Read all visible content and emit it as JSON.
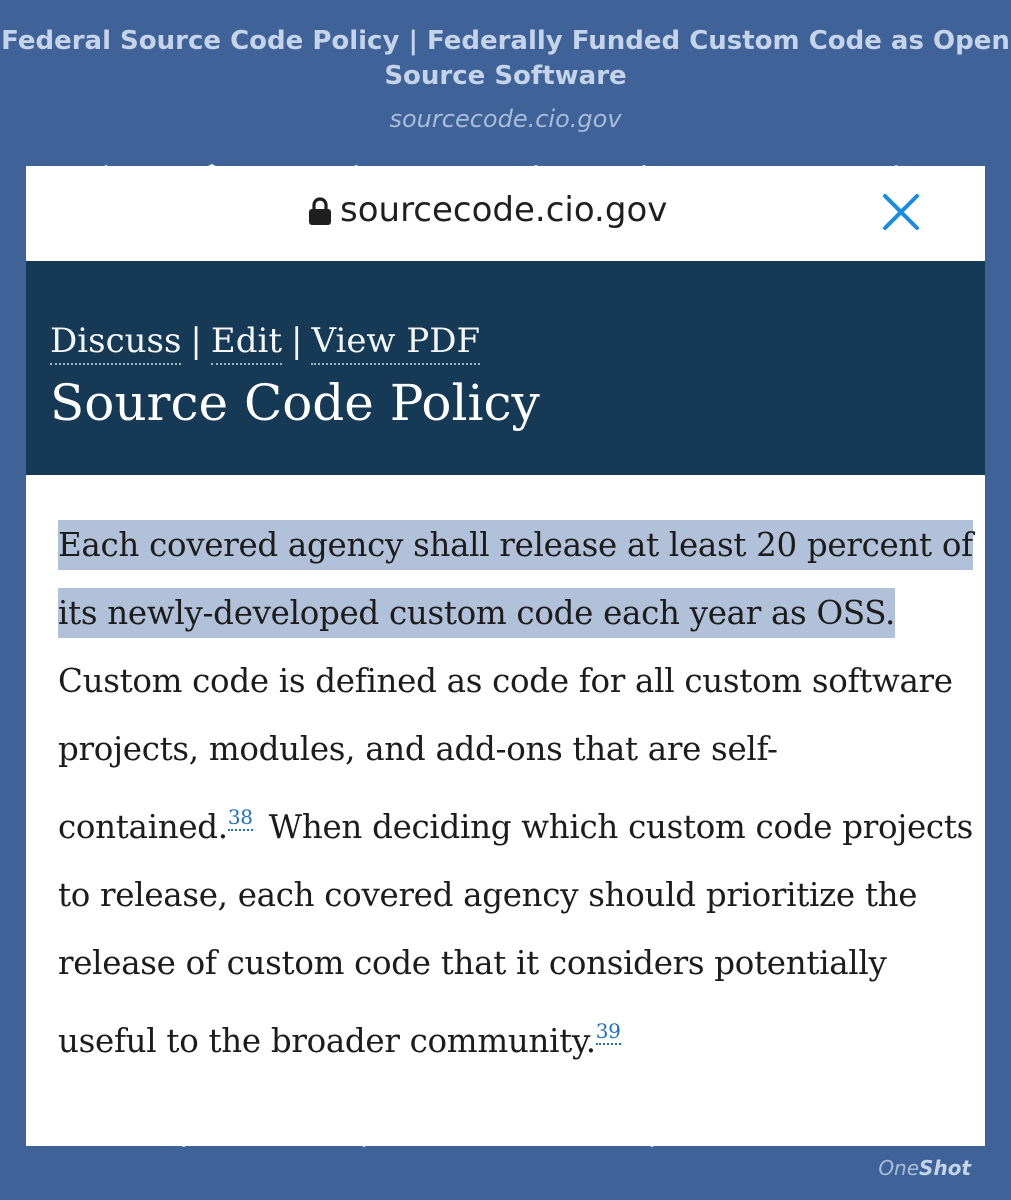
{
  "header": {
    "title": "Federal Source Code Policy | Federally Funded Custom Code as Open Source Software",
    "subtitle": "sourcecode.cio.gov"
  },
  "browser": {
    "url": "sourcecode.cio.gov",
    "lock_icon": "lock-icon",
    "close_icon": "close-icon",
    "accent": "#1a8ce0"
  },
  "page": {
    "nav": {
      "discuss": "Discuss",
      "separator": "|",
      "edit": "Edit",
      "view_pdf": "View PDF"
    },
    "title": "Source Code Policy",
    "banner_color": "#163a56",
    "highlight_color": "#b1c1d9",
    "paragraph": {
      "highlighted": "Each covered agency shall release at least 20 percent of its newly-developed custom code each year as OSS.",
      "part2": " Custom code is defined as code for all custom software projects, modules, and add-ons that are self-contained.",
      "footnote1": "38",
      "part3": " When deciding which custom code projects to release, each covered agency should prioritize the release of custom code that it considers potentially useful to the broader community.",
      "footnote2": "39"
    }
  },
  "watermark": {
    "prefix": "One",
    "suffix": "Shot"
  }
}
